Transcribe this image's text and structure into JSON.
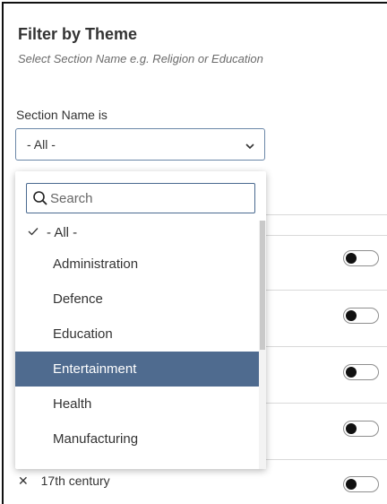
{
  "panel": {
    "title": "Filter by Theme",
    "subtitle": "Select Section Name e.g. Religion or Education"
  },
  "field": {
    "label": "Section Name is",
    "selected_value": "- All -"
  },
  "dropdown": {
    "search_placeholder": "Search",
    "options": [
      {
        "label": "- All -",
        "checked": true
      },
      {
        "label": "Administration"
      },
      {
        "label": "Defence"
      },
      {
        "label": "Education"
      },
      {
        "label": "Entertainment",
        "highlighted": true
      },
      {
        "label": "Health"
      },
      {
        "label": "Manufacturing"
      }
    ]
  },
  "background_list": {
    "partial_item_label": "17th century",
    "toggles_on": [
      false,
      false,
      false,
      false,
      false,
      false
    ]
  },
  "colors": {
    "highlight": "#4f6b8f",
    "border_accent": "#4a6a90"
  }
}
